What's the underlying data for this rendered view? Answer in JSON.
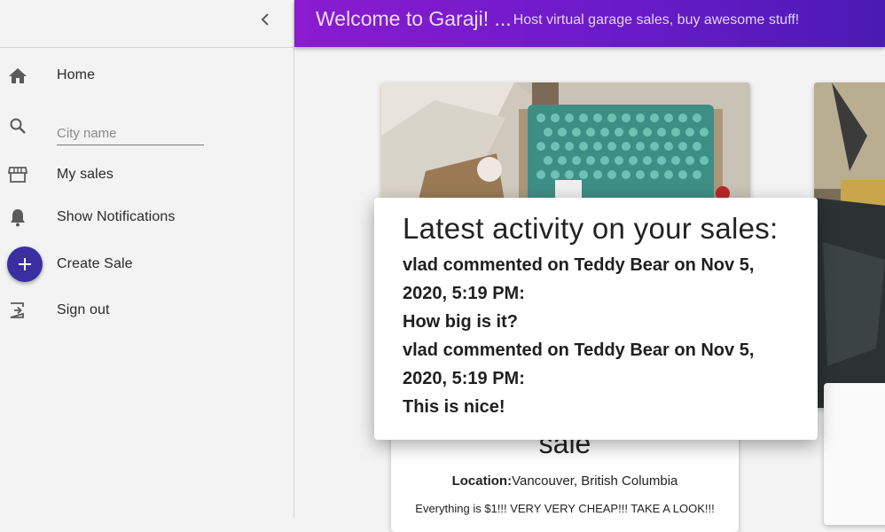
{
  "sidebar": {
    "items": [
      {
        "label": "Home",
        "icon": "home-icon"
      },
      {
        "label": "",
        "icon": "search-icon"
      },
      {
        "label": "My sales",
        "icon": "store-icon"
      },
      {
        "label": "Show Notifications",
        "icon": "bell-icon"
      },
      {
        "label": "Create Sale",
        "icon": "plus-icon"
      },
      {
        "label": "Sign out",
        "icon": "sign-out-icon"
      }
    ],
    "search": {
      "placeholder": "City name",
      "value": ""
    },
    "collapse_icon": "chevron-left-icon"
  },
  "header": {
    "title": "Welcome to Garaji! ...",
    "subtitle": "Host virtual garage sales, buy awesome stuff!"
  },
  "card": {
    "title_fragment": "sale",
    "location_label": "Location:",
    "location_value": "Vancouver, British Columbia",
    "description": "Everything is $1!!! VERY VERY CHEAP!!! TAKE A LOOK!!!"
  },
  "modal": {
    "title": "Latest activity on your sales:",
    "activities": [
      {
        "header": "vlad commented on Teddy Bear on Nov 5, 2020, 5:19 PM:",
        "comment": "How big is it?"
      },
      {
        "header": "vlad commented on Teddy Bear on Nov 5, 2020, 5:19 PM:",
        "comment": "This is nice!"
      }
    ]
  },
  "colors": {
    "header_gradient_start": "#8a1bd0",
    "header_gradient_end": "#4a1ab4",
    "fab": "#3b2ea3",
    "sidebar_bg": "#f3f3f3"
  }
}
